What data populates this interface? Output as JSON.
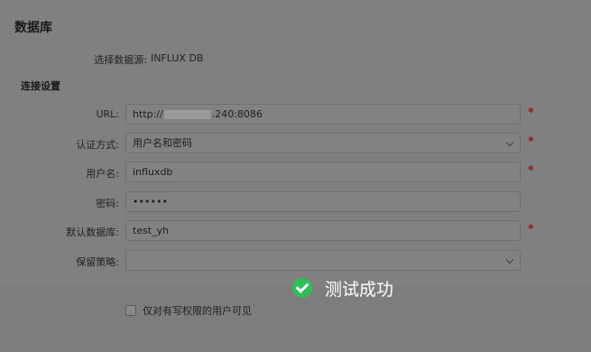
{
  "section": {
    "title": "数据库"
  },
  "datasource": {
    "label": "选择数据源:",
    "value": "INFLUX DB"
  },
  "connection": {
    "title": "连接设置",
    "url": {
      "label": "URL:",
      "prefix": "http://",
      "suffix": ".240:8086",
      "required": "*"
    },
    "auth": {
      "label": "认证方式:",
      "value": "用户名和密码",
      "required": "*"
    },
    "username": {
      "label": "用户名:",
      "value": "influxdb",
      "required": "*"
    },
    "password": {
      "label": "密码:",
      "value": "••••••"
    },
    "default_db": {
      "label": "默认数据库:",
      "value": "test_yh",
      "required": "*"
    },
    "retention": {
      "label": "保留策略:",
      "value": ""
    }
  },
  "toast": {
    "text": "测试成功",
    "icon": "check-circle-icon",
    "color": "#2fbf5a"
  },
  "options": {
    "write_only_label": "仅对有写权限的用户可见"
  }
}
